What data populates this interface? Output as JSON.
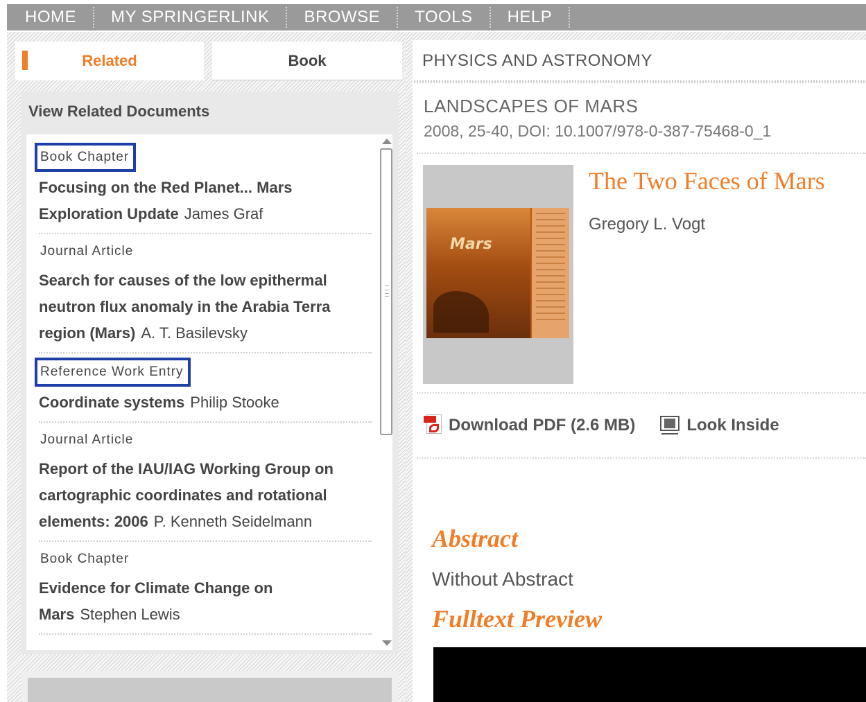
{
  "nav": {
    "items": [
      "HOME",
      "MY SPRINGERLINK",
      "BROWSE",
      "TOOLS",
      "HELP"
    ]
  },
  "tabs": {
    "related": "Related",
    "book": "Book"
  },
  "related": {
    "title": "View Related Documents",
    "entries": [
      {
        "type": "Book Chapter",
        "title": "Focusing on the Red Planet... Mars Exploration Update",
        "author": "James Graf"
      },
      {
        "type": "Journal Article",
        "title": "Search for causes of the low epithermal neutron flux anomaly in the Arabia Terra region (Mars)",
        "author": "A. T. Basilevsky"
      },
      {
        "type": "Reference Work Entry",
        "title": "Coordinate systems",
        "author": "Philip Stooke"
      },
      {
        "type": "Journal Article",
        "title": "Report of the IAU/IAG Working Group on cartographic coordinates and rotational elements: 2006",
        "author": "P. Kenneth Seidelmann"
      },
      {
        "type": "Book Chapter",
        "title": "Evidence for Climate Change on Mars",
        "author": "Stephen Lewis"
      }
    ]
  },
  "main": {
    "subject": "PHYSICS AND ASTRONOMY",
    "book_title": "LANDSCAPES OF MARS",
    "book_meta": "2008, 25-40, DOI: 10.1007/978-0-387-75468-0_1",
    "chapter_title": "The Two Faces of Mars",
    "chapter_author": "Gregory L. Vogt",
    "cover_text": "Mars",
    "download_label": "Download PDF (2.6 MB)",
    "look_inside_label": "Look Inside",
    "abstract_heading": "Abstract",
    "abstract_text": "Without Abstract",
    "preview_heading": "Fulltext Preview"
  },
  "colors": {
    "accent": "#f07d28",
    "nav_bg": "#9a9a9a",
    "highlight_box": "#1f3fa8"
  }
}
